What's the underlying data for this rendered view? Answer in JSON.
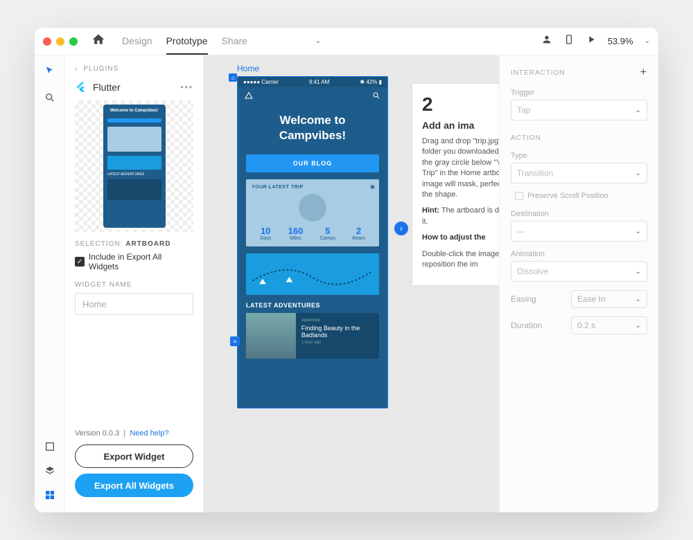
{
  "titlebar": {
    "tabs": [
      "Design",
      "Prototype",
      "Share"
    ],
    "active_tab": "Prototype",
    "zoom": "53.9%"
  },
  "leftpanel": {
    "header": "PLUGINS",
    "plugin_name": "Flutter",
    "thumb_hero": "Welcome to Campvibes!",
    "selection_label": "SELECTION:",
    "selection_value": "ARTBOARD",
    "include_label": "Include in Export All Widgets",
    "widget_name_label": "WIDGET NAME",
    "widget_name_value": "Home",
    "version": "Version 0.0.3",
    "help": "Need help?",
    "export_widget": "Export Widget",
    "export_all": "Export All Widgets"
  },
  "canvas": {
    "artboard_label": "Home",
    "status_carrier": "●●●●● Carrier",
    "status_time": "9:41 AM",
    "status_batt": "42%",
    "hero": "Welcome to Campvibes!",
    "blog_btn": "OUR BLOG",
    "trip_title": "YOUR LATEST TRIP",
    "stats": [
      {
        "n": "10",
        "l": "Days"
      },
      {
        "n": "160",
        "l": "Miles"
      },
      {
        "n": "5",
        "l": "Camps"
      },
      {
        "n": "2",
        "l": "Bears"
      }
    ],
    "adv_header": "LATEST ADVENTURES",
    "adv_cat": "Adventure",
    "adv_title": "Finding Beauty in the Badlands",
    "adv_time": "1 hour ago"
  },
  "tutorial": {
    "num": "2",
    "heading": "Add an ima",
    "body": "Drag and drop \"trip.jpg\" from the folder you downloaded, over top of the gray circle below \"Your Latest Trip\" in the Home artboard. The image will mask, perfectly fitting in the shape.",
    "hint_label": "Hint:",
    "hint": "The artboard is directly above it.",
    "how_label": "How to adjust the",
    "how": "Double-click the image and reposition the im"
  },
  "rightpanel": {
    "interaction_header": "INTERACTION",
    "trigger_label": "Trigger",
    "trigger_value": "Tap",
    "action_header": "ACTION",
    "type_label": "Type",
    "type_value": "Transition",
    "preserve": "Preserve Scroll Position",
    "dest_label": "Destination",
    "dest_value": "—",
    "anim_label": "Animation",
    "anim_value": "Dissolve",
    "easing_label": "Easing",
    "easing_value": "Ease In",
    "duration_label": "Duration",
    "duration_value": "0.2 s"
  }
}
